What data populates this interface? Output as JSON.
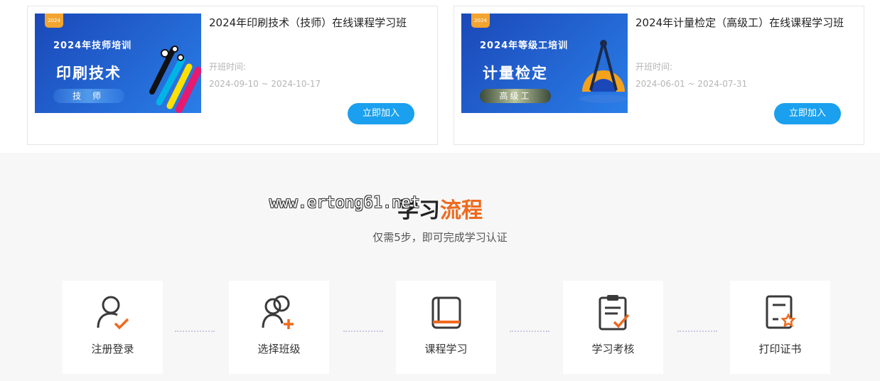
{
  "courses": [
    {
      "thumb": {
        "year": "2024",
        "line1": "2024年技师培训",
        "line2": "印刷技术",
        "line3": "技 师",
        "bg_from": "#1b48b8",
        "bg_to": "#2a7ee8"
      },
      "title": "2024年印刷技术（技师）在线课程学习班",
      "period_label": "开班时间:",
      "period": "2024-09-10 ~ 2024-10-17",
      "join_label": "立即加入"
    },
    {
      "thumb": {
        "year": "2024",
        "line1": "2024年等级工培训",
        "line2": "计量检定",
        "line3": "高级工",
        "bg_from": "#1b48b8",
        "bg_to": "#2a7ee8"
      },
      "title": "2024年计量检定（高级工）在线课程学习班",
      "period_label": "开班时间:",
      "period": "2024-06-01 ~ 2024-07-31",
      "join_label": "立即加入"
    }
  ],
  "process": {
    "title_dark": "学习",
    "title_accent": "流程",
    "subtitle": "仅需5步，即可完成学习认证",
    "watermark": "www.ertong61.net",
    "steps": [
      {
        "label": "注册登录",
        "icon": "user-check-icon"
      },
      {
        "label": "选择班级",
        "icon": "users-add-icon"
      },
      {
        "label": "课程学习",
        "icon": "book-icon"
      },
      {
        "label": "学习考核",
        "icon": "clipboard-check-icon"
      },
      {
        "label": "打印证书",
        "icon": "certificate-icon"
      }
    ]
  },
  "colors": {
    "accent": "#ee6a1f",
    "button": "#1aa0ee",
    "icon": "#3a3a3a"
  }
}
